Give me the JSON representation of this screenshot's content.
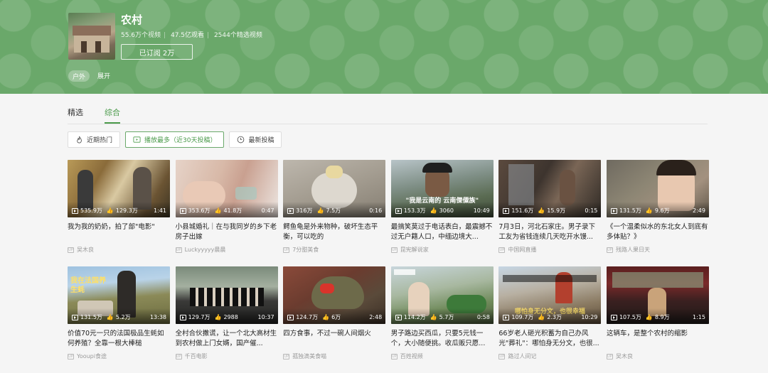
{
  "channel": {
    "title": "农村",
    "stats": [
      "55.6万个视频",
      "47.5亿观看",
      "2544个精选视频"
    ],
    "subscribe_label": "已订阅 2万",
    "tag": "户外",
    "expand_label": "展开"
  },
  "tabs": [
    {
      "label": "精选",
      "active": false
    },
    {
      "label": "综合",
      "active": true
    }
  ],
  "filters": [
    {
      "label": "近期热门",
      "icon": "flame-icon",
      "active": false
    },
    {
      "label": "播放最多（近30天投稿）",
      "icon": "play-box-icon",
      "active": true
    },
    {
      "label": "最新投稿",
      "icon": "clock-icon",
      "active": false
    }
  ],
  "colors": {
    "accent": "#4a9a4a",
    "header": "#6aa86a"
  },
  "videos": [
    {
      "views": "535.9万",
      "likes": "129.3万",
      "duration": "1:41",
      "title": "我为我的奶奶，拍了部\"电影\"",
      "author": "吴木良",
      "caption": ""
    },
    {
      "views": "353.6万",
      "likes": "41.8万",
      "duration": "0:47",
      "title": "小县城婚礼｜在与我同岁的乡下老房子出嫁",
      "author": "Luckyyyyy晨晨",
      "caption": ""
    },
    {
      "views": "316万",
      "likes": "7.5万",
      "duration": "0:16",
      "title": "鳄鱼龟是外来物种，破坏生态平衡，可以吃的",
      "author": "7分甜美食",
      "caption": ""
    },
    {
      "views": "153.3万",
      "likes": "3060",
      "duration": "10:49",
      "title": "最搞笑莫过于电话表白，最震撼不过无户籍人口，中缅边境大...",
      "author": "昆宪解说家",
      "caption": "\"我是云南的 云南傈僳族\""
    },
    {
      "views": "151.6万",
      "likes": "15.9万",
      "duration": "0:15",
      "title": "7月3日，河北石家庄。男子录下工友为省钱连续几天吃开水馒...",
      "author": "中国网直播",
      "caption": ""
    },
    {
      "views": "131.5万",
      "likes": "9.6万",
      "duration": "2:49",
      "title": "《一个温柔似水的东北女人到底有多体贴？》",
      "author": "残路人果日天",
      "caption": ""
    },
    {
      "views": "131.5万",
      "likes": "5.2万",
      "duration": "13:38",
      "title": "价值70元一只的法国极品生蚝如何养殖？全靠一根大棒槌",
      "author": "Yooupi食途",
      "caption": "我在法国养生蚝"
    },
    {
      "views": "129.7万",
      "likes": "2988",
      "duration": "10:37",
      "title": "全村合伙撒谎，让一个北大高材生到农村做上门女婿，国产催...",
      "author": "千百电影",
      "caption": ""
    },
    {
      "views": "124.7万",
      "likes": "6万",
      "duration": "2:48",
      "title": "四方食事，不过一碗人间烟火",
      "author": "孤独滴美食喵",
      "caption": ""
    },
    {
      "views": "114.2万",
      "likes": "5.7万",
      "duration": "0:58",
      "title": "男子路边买西瓜，只要5元钱一个，大小随便挑。收瓜贩只愿...",
      "author": "百姓视频",
      "caption": ""
    },
    {
      "views": "109.7万",
      "likes": "2.3万",
      "duration": "10:29",
      "title": "66岁老人砸光积蓄为自己办风光\"葬礼\"：哪怕身无分文，也很...",
      "author": "路过人间记",
      "caption": "哪怕身无分文，也很幸福"
    },
    {
      "views": "107.5万",
      "likes": "8.9万",
      "duration": "1:15",
      "title": "这辆车，是整个农村的缩影",
      "author": "吴木良",
      "caption": ""
    }
  ]
}
